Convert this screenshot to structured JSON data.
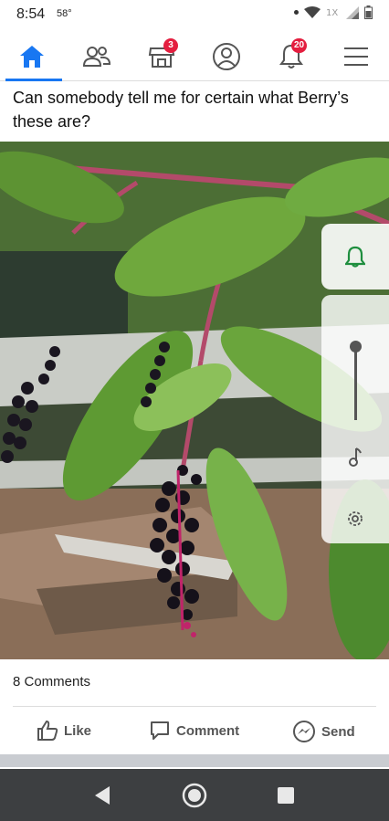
{
  "status": {
    "time": "8:54",
    "temp": "58°"
  },
  "tabs": {
    "home": "home-icon",
    "friends": "friends-icon",
    "marketplace_badge": "3",
    "profile": "profile-icon",
    "notifications_badge": "20",
    "menu": "menu-icon"
  },
  "post": {
    "text": "Can somebody tell me for certain what Berry’s these are?",
    "comments": "8 Comments"
  },
  "actions": {
    "like": "Like",
    "comment": "Comment",
    "send": "Send"
  },
  "colors": {
    "accent": "#1877f2",
    "badge": "#e41e3f",
    "volume_accent": "#1e8e3e"
  }
}
